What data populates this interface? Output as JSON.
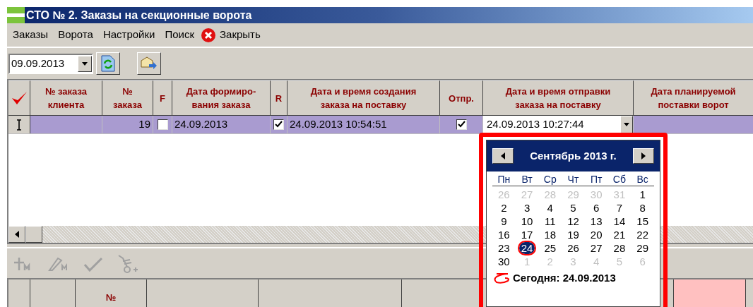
{
  "window": {
    "title": "СТО № 2. Заказы на секционные ворота"
  },
  "menu": [
    {
      "label": "Заказы",
      "kind": "text"
    },
    {
      "label": "Ворота",
      "kind": "text"
    },
    {
      "label": "Настройки",
      "kind": "text"
    },
    {
      "label": "Поиск",
      "kind": "text"
    },
    {
      "label": "Закрыть",
      "kind": "close"
    }
  ],
  "toolbar": {
    "date_value": "09.09.2013"
  },
  "grid": {
    "columns": [
      {
        "kind": "marker"
      },
      {
        "label": "№ заказа\nклиента"
      },
      {
        "label": "№\nзаказа"
      },
      {
        "label": "F"
      },
      {
        "label": "Дата формиро-\nвания заказа"
      },
      {
        "label": "R"
      },
      {
        "label": "Дата и время создания\nзаказа на поставку"
      },
      {
        "label": "Отпр."
      },
      {
        "label": "Дата и время отправки\nзаказа на поставку"
      },
      {
        "label": "Дата планируемой\nпоставки ворот"
      }
    ],
    "row": [
      {
        "kind": "cursor"
      },
      {
        "kind": "empty"
      },
      {
        "kind": "number",
        "text": "19"
      },
      {
        "kind": "check",
        "checked": false
      },
      {
        "kind": "text",
        "text": "24.09.2013"
      },
      {
        "kind": "check",
        "checked": true
      },
      {
        "kind": "text",
        "text": "24.09.2013 10:54:51"
      },
      {
        "kind": "check",
        "checked": true
      },
      {
        "kind": "editor",
        "text": "24.09.2013 10:27:44"
      },
      {
        "kind": "empty"
      }
    ]
  },
  "calendar": {
    "month": "Сентябрь 2013 г.",
    "weekdays": [
      "Пн",
      "Вт",
      "Ср",
      "Чт",
      "Пт",
      "Сб",
      "Вс"
    ],
    "weeks": [
      [
        {
          "day": "26",
          "other": true,
          "selected": false
        },
        {
          "day": "27",
          "other": true,
          "selected": false
        },
        {
          "day": "28",
          "other": true,
          "selected": false
        },
        {
          "day": "29",
          "other": true,
          "selected": false
        },
        {
          "day": "30",
          "other": true,
          "selected": false
        },
        {
          "day": "31",
          "other": true,
          "selected": false
        },
        {
          "day": "1",
          "other": false,
          "selected": false
        }
      ],
      [
        {
          "day": "2",
          "other": false,
          "selected": false
        },
        {
          "day": "3",
          "other": false,
          "selected": false
        },
        {
          "day": "4",
          "other": false,
          "selected": false
        },
        {
          "day": "5",
          "other": false,
          "selected": false
        },
        {
          "day": "6",
          "other": false,
          "selected": false
        },
        {
          "day": "7",
          "other": false,
          "selected": false
        },
        {
          "day": "8",
          "other": false,
          "selected": false
        }
      ],
      [
        {
          "day": "9",
          "other": false,
          "selected": false
        },
        {
          "day": "10",
          "other": false,
          "selected": false
        },
        {
          "day": "11",
          "other": false,
          "selected": false
        },
        {
          "day": "12",
          "other": false,
          "selected": false
        },
        {
          "day": "13",
          "other": false,
          "selected": false
        },
        {
          "day": "14",
          "other": false,
          "selected": false
        },
        {
          "day": "15",
          "other": false,
          "selected": false
        }
      ],
      [
        {
          "day": "16",
          "other": false,
          "selected": false
        },
        {
          "day": "17",
          "other": false,
          "selected": false
        },
        {
          "day": "18",
          "other": false,
          "selected": false
        },
        {
          "day": "19",
          "other": false,
          "selected": false
        },
        {
          "day": "20",
          "other": false,
          "selected": false
        },
        {
          "day": "21",
          "other": false,
          "selected": false
        },
        {
          "day": "22",
          "other": false,
          "selected": false
        }
      ],
      [
        {
          "day": "23",
          "other": false,
          "selected": false
        },
        {
          "day": "24",
          "other": false,
          "selected": true
        },
        {
          "day": "25",
          "other": false,
          "selected": false
        },
        {
          "day": "26",
          "other": false,
          "selected": false
        },
        {
          "day": "27",
          "other": false,
          "selected": false
        },
        {
          "day": "28",
          "other": false,
          "selected": false
        },
        {
          "day": "29",
          "other": false,
          "selected": false
        }
      ],
      [
        {
          "day": "30",
          "other": false,
          "selected": false
        },
        {
          "day": "1",
          "other": true,
          "selected": false
        },
        {
          "day": "2",
          "other": true,
          "selected": false
        },
        {
          "day": "3",
          "other": true,
          "selected": false
        },
        {
          "day": "4",
          "other": true,
          "selected": false
        },
        {
          "day": "5",
          "other": true,
          "selected": false
        },
        {
          "day": "6",
          "other": true,
          "selected": false
        }
      ]
    ],
    "today": "Сегодня: 24.09.2013"
  },
  "bottom_grid": {
    "columns": [
      {},
      {},
      {
        "label": "№"
      },
      {},
      {},
      {},
      {},
      {},
      {
        "color": "#ffc0c0"
      },
      {}
    ]
  }
}
